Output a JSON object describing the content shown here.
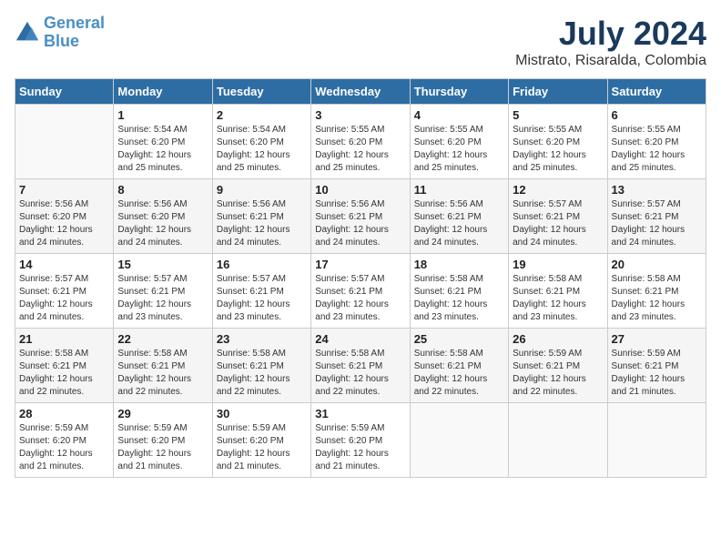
{
  "logo": {
    "line1": "General",
    "line2": "Blue"
  },
  "title": "July 2024",
  "location": "Mistrato, Risaralda, Colombia",
  "days_of_week": [
    "Sunday",
    "Monday",
    "Tuesday",
    "Wednesday",
    "Thursday",
    "Friday",
    "Saturday"
  ],
  "weeks": [
    [
      {
        "day": "",
        "info": ""
      },
      {
        "day": "1",
        "info": "Sunrise: 5:54 AM\nSunset: 6:20 PM\nDaylight: 12 hours\nand 25 minutes."
      },
      {
        "day": "2",
        "info": "Sunrise: 5:54 AM\nSunset: 6:20 PM\nDaylight: 12 hours\nand 25 minutes."
      },
      {
        "day": "3",
        "info": "Sunrise: 5:55 AM\nSunset: 6:20 PM\nDaylight: 12 hours\nand 25 minutes."
      },
      {
        "day": "4",
        "info": "Sunrise: 5:55 AM\nSunset: 6:20 PM\nDaylight: 12 hours\nand 25 minutes."
      },
      {
        "day": "5",
        "info": "Sunrise: 5:55 AM\nSunset: 6:20 PM\nDaylight: 12 hours\nand 25 minutes."
      },
      {
        "day": "6",
        "info": "Sunrise: 5:55 AM\nSunset: 6:20 PM\nDaylight: 12 hours\nand 25 minutes."
      }
    ],
    [
      {
        "day": "7",
        "info": "Sunrise: 5:56 AM\nSunset: 6:20 PM\nDaylight: 12 hours\nand 24 minutes."
      },
      {
        "day": "8",
        "info": "Sunrise: 5:56 AM\nSunset: 6:20 PM\nDaylight: 12 hours\nand 24 minutes."
      },
      {
        "day": "9",
        "info": "Sunrise: 5:56 AM\nSunset: 6:21 PM\nDaylight: 12 hours\nand 24 minutes."
      },
      {
        "day": "10",
        "info": "Sunrise: 5:56 AM\nSunset: 6:21 PM\nDaylight: 12 hours\nand 24 minutes."
      },
      {
        "day": "11",
        "info": "Sunrise: 5:56 AM\nSunset: 6:21 PM\nDaylight: 12 hours\nand 24 minutes."
      },
      {
        "day": "12",
        "info": "Sunrise: 5:57 AM\nSunset: 6:21 PM\nDaylight: 12 hours\nand 24 minutes."
      },
      {
        "day": "13",
        "info": "Sunrise: 5:57 AM\nSunset: 6:21 PM\nDaylight: 12 hours\nand 24 minutes."
      }
    ],
    [
      {
        "day": "14",
        "info": "Sunrise: 5:57 AM\nSunset: 6:21 PM\nDaylight: 12 hours\nand 24 minutes."
      },
      {
        "day": "15",
        "info": "Sunrise: 5:57 AM\nSunset: 6:21 PM\nDaylight: 12 hours\nand 23 minutes."
      },
      {
        "day": "16",
        "info": "Sunrise: 5:57 AM\nSunset: 6:21 PM\nDaylight: 12 hours\nand 23 minutes."
      },
      {
        "day": "17",
        "info": "Sunrise: 5:57 AM\nSunset: 6:21 PM\nDaylight: 12 hours\nand 23 minutes."
      },
      {
        "day": "18",
        "info": "Sunrise: 5:58 AM\nSunset: 6:21 PM\nDaylight: 12 hours\nand 23 minutes."
      },
      {
        "day": "19",
        "info": "Sunrise: 5:58 AM\nSunset: 6:21 PM\nDaylight: 12 hours\nand 23 minutes."
      },
      {
        "day": "20",
        "info": "Sunrise: 5:58 AM\nSunset: 6:21 PM\nDaylight: 12 hours\nand 23 minutes."
      }
    ],
    [
      {
        "day": "21",
        "info": "Sunrise: 5:58 AM\nSunset: 6:21 PM\nDaylight: 12 hours\nand 22 minutes."
      },
      {
        "day": "22",
        "info": "Sunrise: 5:58 AM\nSunset: 6:21 PM\nDaylight: 12 hours\nand 22 minutes."
      },
      {
        "day": "23",
        "info": "Sunrise: 5:58 AM\nSunset: 6:21 PM\nDaylight: 12 hours\nand 22 minutes."
      },
      {
        "day": "24",
        "info": "Sunrise: 5:58 AM\nSunset: 6:21 PM\nDaylight: 12 hours\nand 22 minutes."
      },
      {
        "day": "25",
        "info": "Sunrise: 5:58 AM\nSunset: 6:21 PM\nDaylight: 12 hours\nand 22 minutes."
      },
      {
        "day": "26",
        "info": "Sunrise: 5:59 AM\nSunset: 6:21 PM\nDaylight: 12 hours\nand 22 minutes."
      },
      {
        "day": "27",
        "info": "Sunrise: 5:59 AM\nSunset: 6:21 PM\nDaylight: 12 hours\nand 21 minutes."
      }
    ],
    [
      {
        "day": "28",
        "info": "Sunrise: 5:59 AM\nSunset: 6:20 PM\nDaylight: 12 hours\nand 21 minutes."
      },
      {
        "day": "29",
        "info": "Sunrise: 5:59 AM\nSunset: 6:20 PM\nDaylight: 12 hours\nand 21 minutes."
      },
      {
        "day": "30",
        "info": "Sunrise: 5:59 AM\nSunset: 6:20 PM\nDaylight: 12 hours\nand 21 minutes."
      },
      {
        "day": "31",
        "info": "Sunrise: 5:59 AM\nSunset: 6:20 PM\nDaylight: 12 hours\nand 21 minutes."
      },
      {
        "day": "",
        "info": ""
      },
      {
        "day": "",
        "info": ""
      },
      {
        "day": "",
        "info": ""
      }
    ]
  ]
}
